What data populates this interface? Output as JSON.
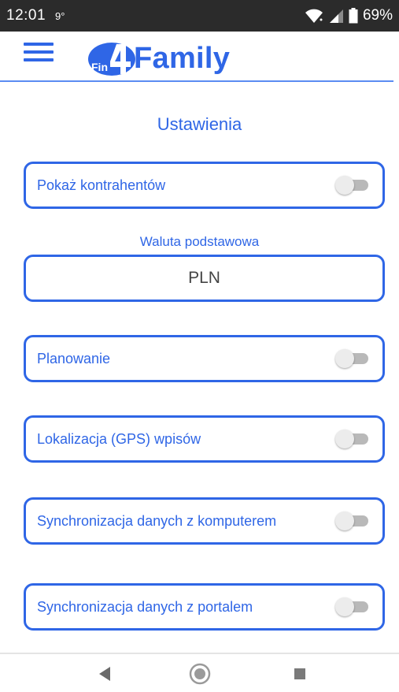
{
  "status_bar": {
    "time": "12:01",
    "temperature": "9°",
    "battery": "69%"
  },
  "header": {
    "logo_mark_text": "Fin4",
    "app_name": "Family",
    "accent_color": "#2f66e6"
  },
  "settings": {
    "title": "Ustawienia",
    "show_contractors_label": "Pokaż kontrahentów",
    "base_currency_label": "Waluta podstawowa",
    "base_currency_value": "PLN",
    "planning_label": "Planowanie",
    "gps_label": "Lokalizacja (GPS) wpisów",
    "sync_computer_label": "Synchronizacja danych z komputerem",
    "sync_portal_label": "Synchronizacja danych z portalem"
  },
  "toggles": {
    "show_contractors": false,
    "planning": false,
    "gps": false,
    "sync_computer": false,
    "sync_portal": false
  },
  "icons": {
    "menu": "hamburger-menu-icon",
    "wifi": "wifi-icon",
    "signal": "signal-icon",
    "battery": "battery-icon",
    "back": "back-triangle-icon",
    "home": "home-circle-icon",
    "recents": "recents-square-icon"
  }
}
